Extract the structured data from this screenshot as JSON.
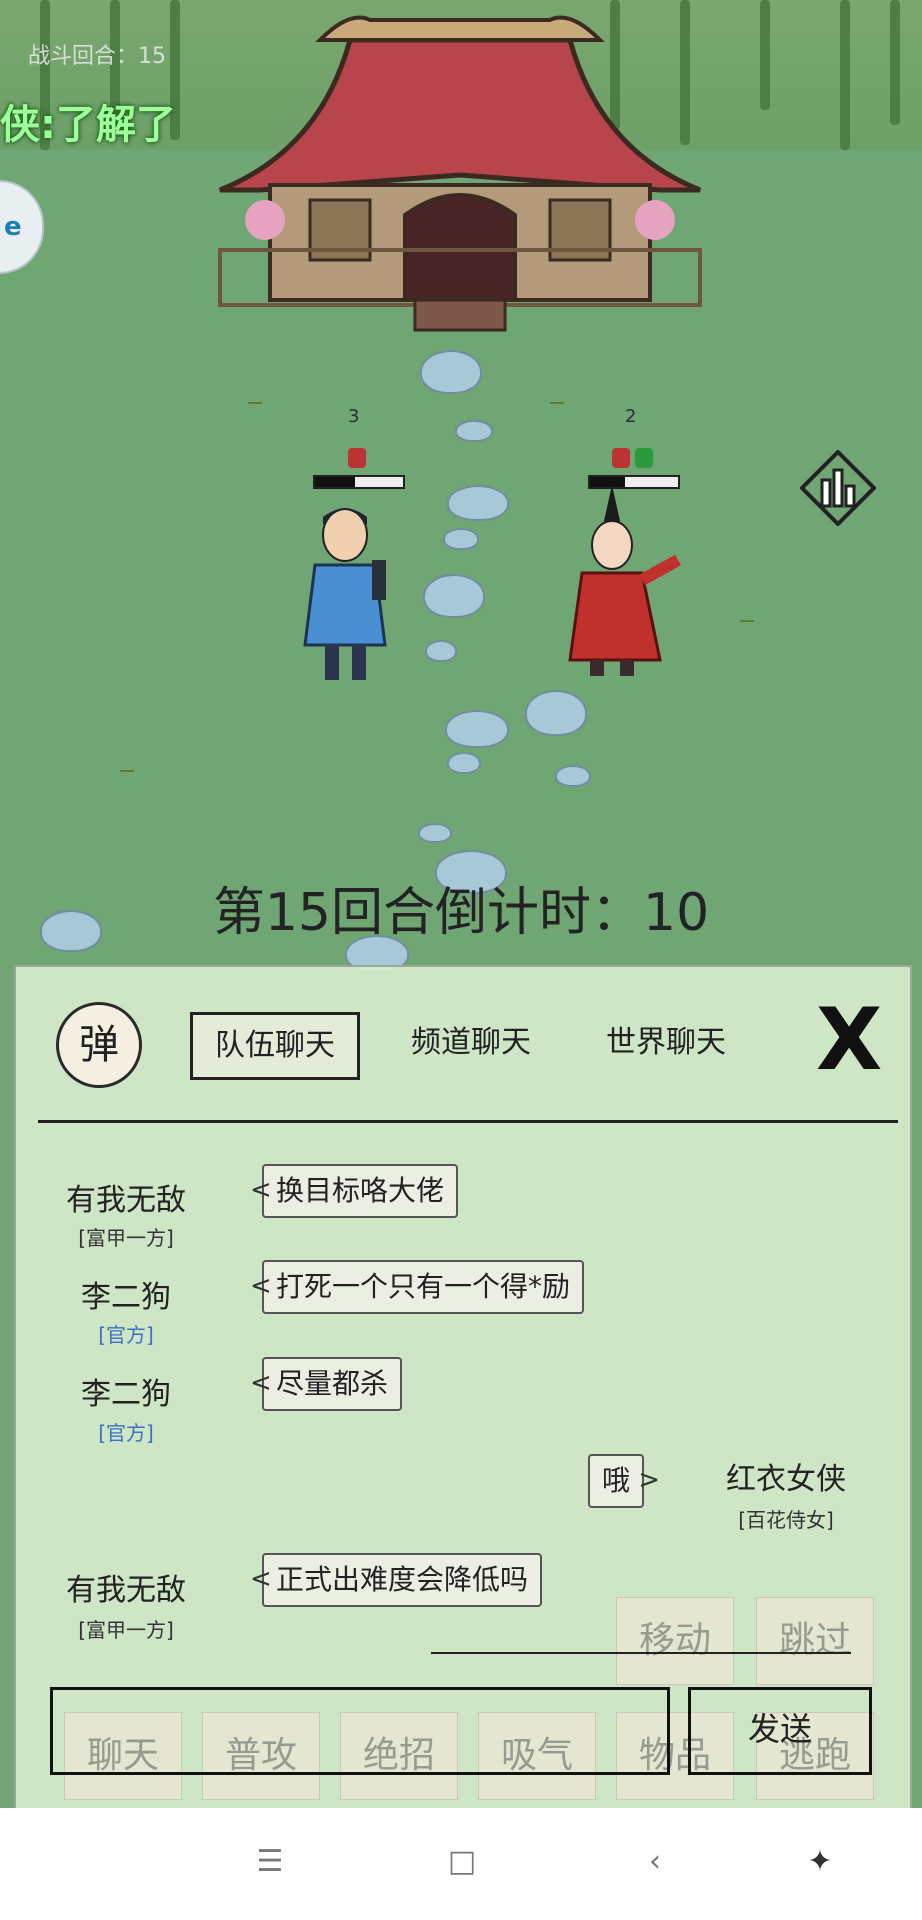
{
  "hud": {
    "round_label": "战斗回合：15",
    "speech_text": "侠:了解了"
  },
  "battle": {
    "player_level": "3",
    "enemy_level": "2",
    "player_hp_fraction": 0.45,
    "enemy_hp_fraction": 0.4,
    "countdown": "第15回合倒计时：10"
  },
  "chat": {
    "danmu_label": "弹",
    "tabs": [
      "队伍聊天",
      "频道聊天",
      "世界聊天"
    ],
    "active_tab": 0,
    "close_label": "X",
    "messages": [
      {
        "name": "有我无敌",
        "title": "[富甲一方]",
        "text": "换目标咯大佬",
        "side": "left"
      },
      {
        "name": "李二狗",
        "title": "[官方]",
        "text": "打死一个只有一个得*励",
        "side": "left"
      },
      {
        "name": "李二狗",
        "title": "[官方]",
        "text": "尽量都杀",
        "side": "left"
      },
      {
        "name": "红衣女侠",
        "title": "[百花侍女]",
        "text": "哦",
        "side": "right"
      },
      {
        "name": "有我无敌",
        "title": "[富甲一方]",
        "text": "正式出难度会降低吗",
        "side": "left"
      }
    ],
    "send_label": "发送"
  },
  "actions": {
    "move": "移动",
    "skip": "跳过",
    "chat": "聊天",
    "attack": "普攻",
    "ultimate": "绝招",
    "absorb": "吸气",
    "items": "物品",
    "flee": "逃跑"
  },
  "navbar": {
    "icons": [
      "menu-icon",
      "home-icon",
      "back-icon",
      "accessibility-icon"
    ]
  },
  "colors": {
    "grass": "#70a574",
    "chat_panel": "#d6eccc",
    "official_title": "#3b73c2",
    "speech_green": "#9cff9a"
  }
}
